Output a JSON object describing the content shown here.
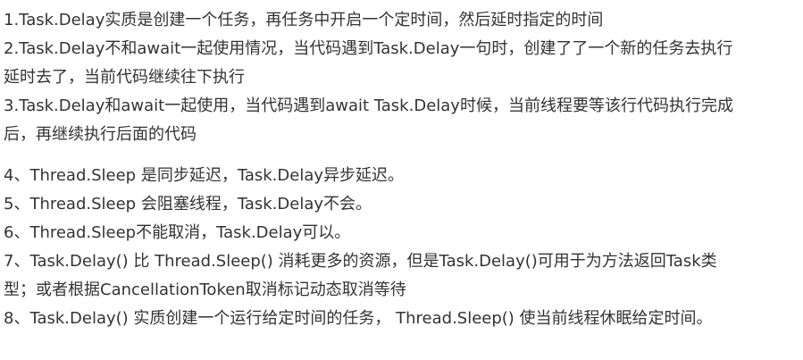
{
  "paragraph1": {
    "lines": [
      "1.Task.Delay实质是创建一个任务，再任务中开启一个定时间，然后延时指定的时间",
      "2.Task.Delay不和await一起使用情况，当代码遇到Task.Delay一句时，创建了了一个新的任务去执行",
      "延时去了，当前代码继续往下执行",
      "3.Task.Delay和await一起使用，当代码遇到await Task.Delay时候，当前线程要等该行代码执行完成",
      "后，再继续执行后面的代码"
    ]
  },
  "paragraph2": {
    "lines": [
      "4、Thread.Sleep 是同步延迟，Task.Delay异步延迟。",
      "5、Thread.Sleep 会阻塞线程，Task.Delay不会。",
      "6、Thread.Sleep不能取消，Task.Delay可以。",
      "7、Task.Delay() 比 Thread.Sleep() 消耗更多的资源，但是Task.Delay()可用于为方法返回Task类",
      "型；或者根据CancellationToken取消标记动态取消等待",
      "8、Task.Delay() 实质创建一个运行给定时间的任务， Thread.Sleep() 使当前线程休眠给定时间。"
    ]
  }
}
